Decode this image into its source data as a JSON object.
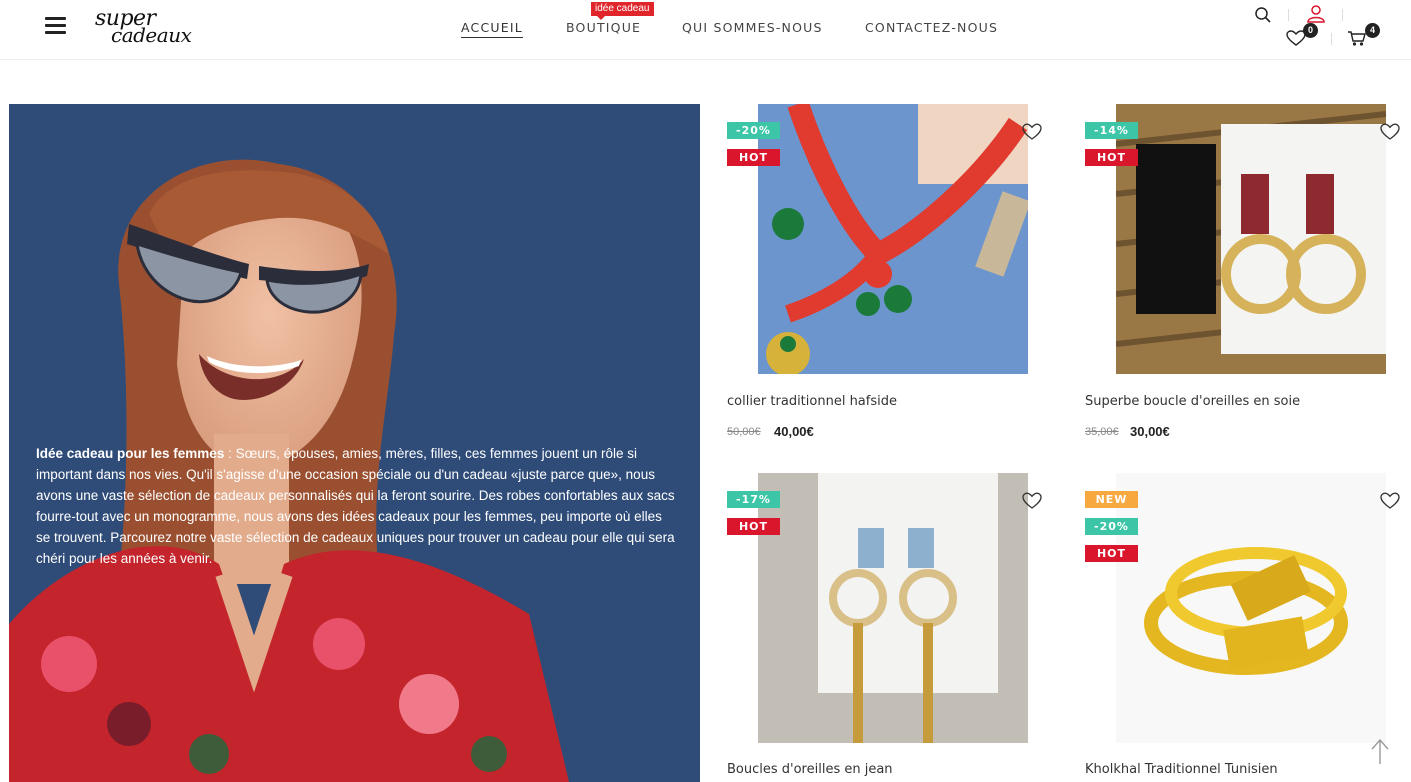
{
  "colors": {
    "hot": "#d9162c",
    "sale": "#3cc5a6",
    "new": "#f7a93f",
    "banner_bg": "#2f4c79",
    "nav_badge": "#e0262b"
  },
  "header": {
    "logo_line1": "super",
    "logo_line2": "cadeaux",
    "nav": [
      {
        "label": "ACCUEIL",
        "active": true
      },
      {
        "label": "BOUTIQUE",
        "badge": "idée cadeau"
      },
      {
        "label": "QUI SOMMES-NOUS"
      },
      {
        "label": "CONTACTEZ-NOUS"
      }
    ],
    "icons": [
      "menu-icon",
      "search-icon",
      "user-icon",
      "heart-icon",
      "cart-icon"
    ],
    "wishlist_count": "0",
    "cart_count": "4"
  },
  "banner": {
    "bold": "Idée cadeau pour les femmes",
    "text": " : Sœurs, épouses, amies, mères, filles, ces femmes jouent un rôle si important dans nos vies. Qu'il s'agisse d'une occasion spéciale ou d'un cadeau «juste parce que», nous avons une vaste sélection de cadeaux personnalisés qui la feront sourire. Des robes confortables aux sacs fourre-tout avec un monogramme, nous avons des idées cadeaux pour les femmes, peu importe où elles se trouvent. Parcourez notre vaste sélection de cadeaux uniques pour trouver un cadeau pour elle qui sera chéri pour les années à venir."
  },
  "products": [
    {
      "title": "collier traditionnel hafside",
      "old_price": "50,00€",
      "price": "40,00€",
      "badges": [
        "-20%",
        "HOT"
      ]
    },
    {
      "title": "Superbe boucle d'oreilles en soie",
      "old_price": "35,00€",
      "price": "30,00€",
      "badges": [
        "-14%",
        "HOT"
      ]
    },
    {
      "title": "Boucles d'oreilles en jean",
      "badges": [
        "-17%",
        "HOT"
      ]
    },
    {
      "title": "Kholkhal Traditionnel Tunisien",
      "badges": [
        "NEW",
        "-20%",
        "HOT"
      ]
    }
  ]
}
